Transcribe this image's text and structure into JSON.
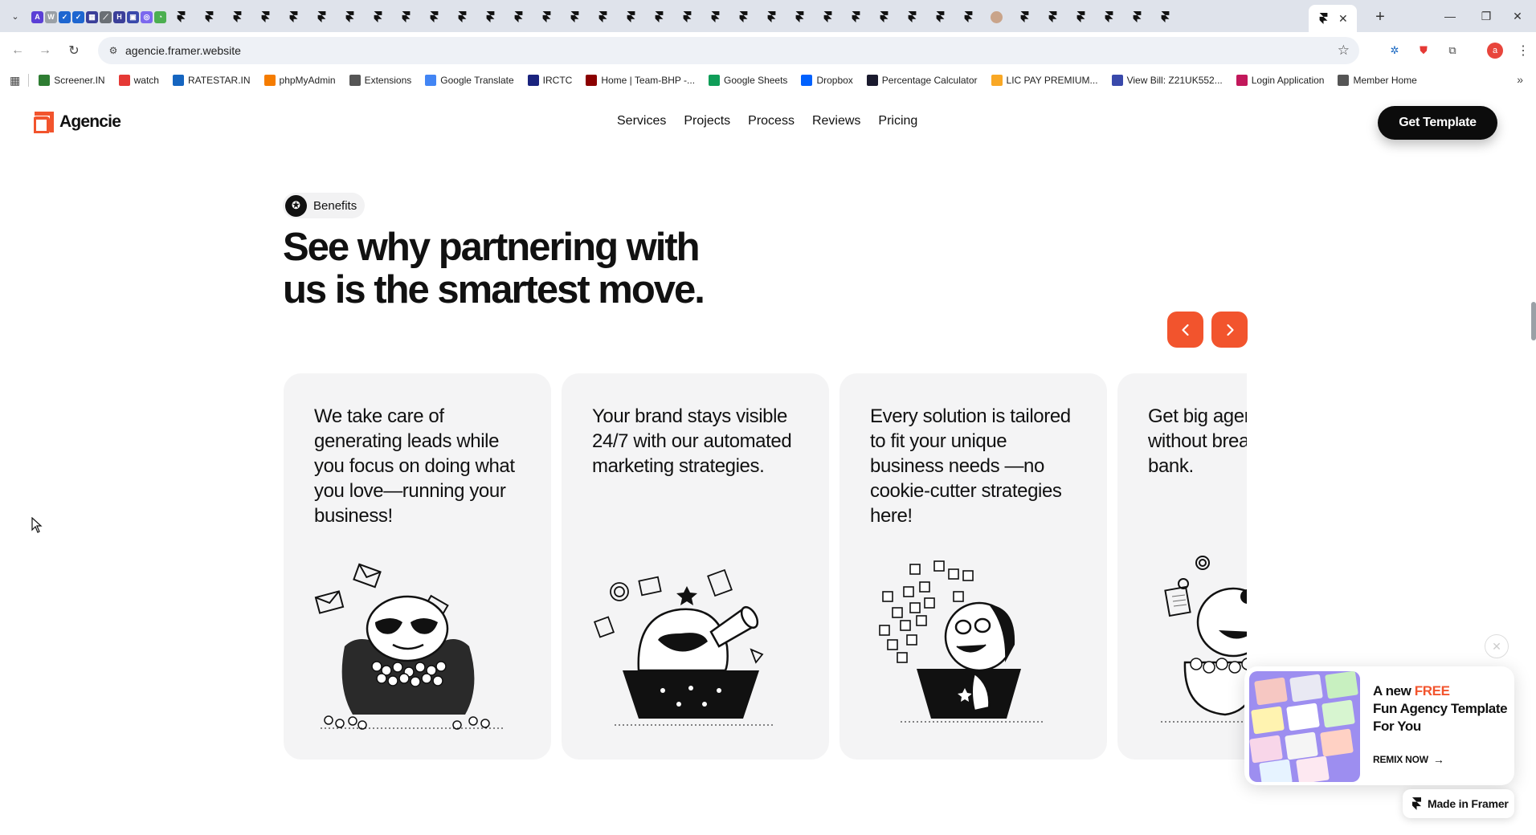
{
  "browser": {
    "url": "agencie.framer.website",
    "tab_count_visible": 46,
    "profile_initial": "a",
    "bookmarks": [
      {
        "label": "Screener.IN",
        "icon": "bar-chart-icon",
        "color": "#2e7d32"
      },
      {
        "label": "watch",
        "icon": "youtube-icon",
        "color": "#e53935"
      },
      {
        "label": "RATESTAR.IN",
        "icon": "ratestar-icon",
        "color": "#1565c0"
      },
      {
        "label": "phpMyAdmin",
        "icon": "phpmyadmin-icon",
        "color": "#f57c00"
      },
      {
        "label": "Extensions",
        "icon": "puzzle-icon",
        "color": "#555555"
      },
      {
        "label": "Google Translate",
        "icon": "translate-icon",
        "color": "#4285f4"
      },
      {
        "label": "IRCTC",
        "icon": "irctc-icon",
        "color": "#1a237e"
      },
      {
        "label": "Home | Team-BHP -...",
        "icon": "teambhp-icon",
        "color": "#8b0000"
      },
      {
        "label": "Google Sheets",
        "icon": "sheets-icon",
        "color": "#0f9d58"
      },
      {
        "label": "Dropbox",
        "icon": "dropbox-icon",
        "color": "#0061fe"
      },
      {
        "label": "Percentage Calculator",
        "icon": "percent-icon",
        "color": "#1a1a2e"
      },
      {
        "label": "LIC PAY PREMIUM...",
        "icon": "lic-icon",
        "color": "#f9a825"
      },
      {
        "label": "View Bill: Z21UK552...",
        "icon": "bill-icon",
        "color": "#3949ab"
      },
      {
        "label": "Login Application",
        "icon": "login-icon",
        "color": "#c2185b"
      },
      {
        "label": "Member Home",
        "icon": "globe-icon",
        "color": "#555555"
      }
    ]
  },
  "site": {
    "brand": "Agencie",
    "brand_color": "#f2542d",
    "nav": [
      "Services",
      "Projects",
      "Process",
      "Reviews",
      "Pricing"
    ],
    "cta_label": "Get Template"
  },
  "section": {
    "badge_label": "Benefits",
    "headline_line1": "See why partnering with",
    "headline_line2": "us is the smartest move.",
    "cards": [
      {
        "text": "We take care of generating leads while you focus on doing what you love—running your business!",
        "illustration": "mascot-armchair-letters-illustration"
      },
      {
        "text": "Your brand stays visible 24/7 with our automated marketing strategies.",
        "illustration": "mascot-megaphone-illustration"
      },
      {
        "text": "Every solution is tailored to fit your unique business needs —no cookie-cutter strategies here!",
        "illustration": "mascot-puzzle-pieces-illustration"
      },
      {
        "text": "Get big agency results without breaking the bank.",
        "illustration": "mascot-coins-illustration"
      }
    ]
  },
  "promo": {
    "title_prefix": "A new ",
    "title_highlight": "FREE",
    "title_rest": "Fun Agency Template For You",
    "remix_label": "REMIX NOW",
    "made_in_label": "Made in Framer"
  }
}
